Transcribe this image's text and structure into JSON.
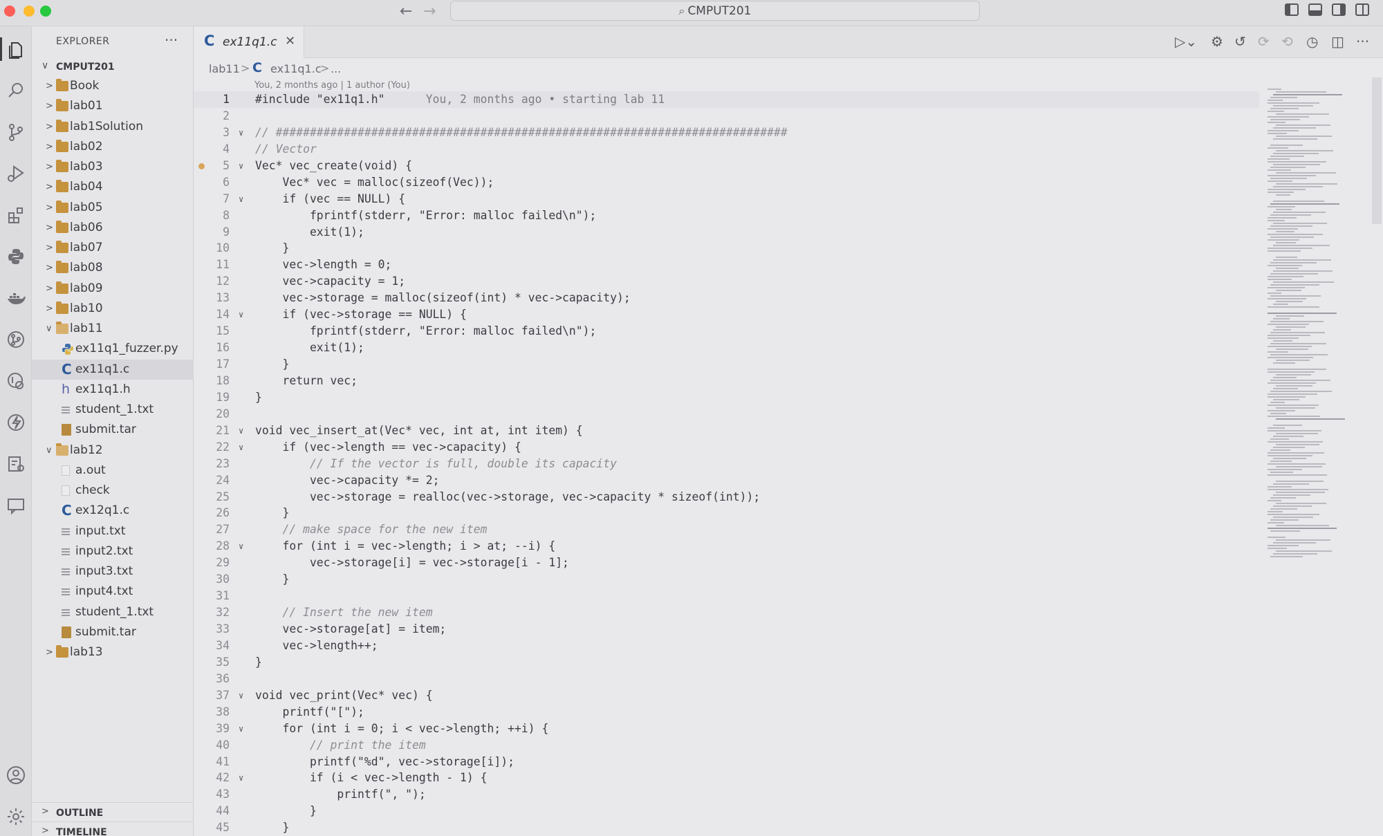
{
  "titlebar": {
    "search_text": "CMPUT201"
  },
  "sidebar": {
    "title": "EXPLORER",
    "workspace": "CMPUT201",
    "items": [
      {
        "name": "Book",
        "type": "folder",
        "depth": 1,
        "open": false
      },
      {
        "name": "lab01",
        "type": "folder",
        "depth": 1,
        "open": false
      },
      {
        "name": "lab1Solution",
        "type": "folder",
        "depth": 1,
        "open": false
      },
      {
        "name": "lab02",
        "type": "folder",
        "depth": 1,
        "open": false
      },
      {
        "name": "lab03",
        "type": "folder",
        "depth": 1,
        "open": false
      },
      {
        "name": "lab04",
        "type": "folder",
        "depth": 1,
        "open": false
      },
      {
        "name": "lab05",
        "type": "folder",
        "depth": 1,
        "open": false
      },
      {
        "name": "lab06",
        "type": "folder",
        "depth": 1,
        "open": false
      },
      {
        "name": "lab07",
        "type": "folder",
        "depth": 1,
        "open": false
      },
      {
        "name": "lab08",
        "type": "folder",
        "depth": 1,
        "open": false
      },
      {
        "name": "lab09",
        "type": "folder",
        "depth": 1,
        "open": false
      },
      {
        "name": "lab10",
        "type": "folder",
        "depth": 1,
        "open": false
      },
      {
        "name": "lab11",
        "type": "folder",
        "depth": 1,
        "open": true
      },
      {
        "name": "ex11q1_fuzzer.py",
        "type": "py",
        "depth": 2
      },
      {
        "name": "ex11q1.c",
        "type": "c",
        "depth": 2,
        "selected": true
      },
      {
        "name": "ex11q1.h",
        "type": "h",
        "depth": 2
      },
      {
        "name": "student_1.txt",
        "type": "txt",
        "depth": 2
      },
      {
        "name": "submit.tar",
        "type": "tar",
        "depth": 2
      },
      {
        "name": "lab12",
        "type": "folder",
        "depth": 1,
        "open": true
      },
      {
        "name": "a.out",
        "type": "blank",
        "depth": 2
      },
      {
        "name": "check",
        "type": "blank",
        "depth": 2
      },
      {
        "name": "ex12q1.c",
        "type": "c",
        "depth": 2
      },
      {
        "name": "input.txt",
        "type": "txt",
        "depth": 2
      },
      {
        "name": "input2.txt",
        "type": "txt",
        "depth": 2
      },
      {
        "name": "input3.txt",
        "type": "txt",
        "depth": 2
      },
      {
        "name": "input4.txt",
        "type": "txt",
        "depth": 2
      },
      {
        "name": "student_1.txt",
        "type": "txt",
        "depth": 2
      },
      {
        "name": "submit.tar",
        "type": "tar",
        "depth": 2
      },
      {
        "name": "lab13",
        "type": "folder",
        "depth": 1,
        "open": false
      }
    ],
    "outline_label": "OUTLINE",
    "timeline_label": "TIMELINE"
  },
  "editor": {
    "tab_label": "ex11q1.c",
    "breadcrumb": {
      "folder": "lab11",
      "file": "ex11q1.c",
      "more": "..."
    },
    "blame_header": "You, 2 months ago | 1 author (You)",
    "lines": [
      {
        "n": "1",
        "text": "#include \"ex11q1.h\"",
        "blame": "You, 2 months ago • starting lab 11",
        "current": true
      },
      {
        "n": "2",
        "text": ""
      },
      {
        "n": "3",
        "text": "// ###########################################################################",
        "fold": true
      },
      {
        "n": "4",
        "text": "// Vector"
      },
      {
        "n": "5",
        "text": "Vec* vec_create(void) {",
        "fold": true,
        "dot": true
      },
      {
        "n": "6",
        "text": "    Vec* vec = malloc(sizeof(Vec));"
      },
      {
        "n": "7",
        "text": "    if (vec == NULL) {",
        "fold": true
      },
      {
        "n": "8",
        "text": "        fprintf(stderr, \"Error: malloc failed\\n\");"
      },
      {
        "n": "9",
        "text": "        exit(1);"
      },
      {
        "n": "10",
        "text": "    }"
      },
      {
        "n": "11",
        "text": "    vec->length = 0;"
      },
      {
        "n": "12",
        "text": "    vec->capacity = 1;"
      },
      {
        "n": "13",
        "text": "    vec->storage = malloc(sizeof(int) * vec->capacity);"
      },
      {
        "n": "14",
        "text": "    if (vec->storage == NULL) {",
        "fold": true
      },
      {
        "n": "15",
        "text": "        fprintf(stderr, \"Error: malloc failed\\n\");"
      },
      {
        "n": "16",
        "text": "        exit(1);"
      },
      {
        "n": "17",
        "text": "    }"
      },
      {
        "n": "18",
        "text": "    return vec;"
      },
      {
        "n": "19",
        "text": "}"
      },
      {
        "n": "20",
        "text": ""
      },
      {
        "n": "21",
        "text": "void vec_insert_at(Vec* vec, int at, int item) {",
        "fold": true
      },
      {
        "n": "22",
        "text": "    if (vec->length == vec->capacity) {",
        "fold": true
      },
      {
        "n": "23",
        "text": "        // If the vector is full, double its capacity"
      },
      {
        "n": "24",
        "text": "        vec->capacity *= 2;"
      },
      {
        "n": "25",
        "text": "        vec->storage = realloc(vec->storage, vec->capacity * sizeof(int));"
      },
      {
        "n": "26",
        "text": "    }"
      },
      {
        "n": "27",
        "text": "    // make space for the new item"
      },
      {
        "n": "28",
        "text": "    for (int i = vec->length; i > at; --i) {",
        "fold": true
      },
      {
        "n": "29",
        "text": "        vec->storage[i] = vec->storage[i - 1];"
      },
      {
        "n": "30",
        "text": "    }"
      },
      {
        "n": "31",
        "text": ""
      },
      {
        "n": "32",
        "text": "    // Insert the new item"
      },
      {
        "n": "33",
        "text": "    vec->storage[at] = item;"
      },
      {
        "n": "34",
        "text": "    vec->length++;"
      },
      {
        "n": "35",
        "text": "}"
      },
      {
        "n": "36",
        "text": ""
      },
      {
        "n": "37",
        "text": "void vec_print(Vec* vec) {",
        "fold": true
      },
      {
        "n": "38",
        "text": "    printf(\"[\");"
      },
      {
        "n": "39",
        "text": "    for (int i = 0; i < vec->length; ++i) {",
        "fold": true
      },
      {
        "n": "40",
        "text": "        // print the item"
      },
      {
        "n": "41",
        "text": "        printf(\"%d\", vec->storage[i]);"
      },
      {
        "n": "42",
        "text": "        if (i < vec->length - 1) {",
        "fold": true
      },
      {
        "n": "43",
        "text": "            printf(\", \");"
      },
      {
        "n": "44",
        "text": "        }"
      },
      {
        "n": "45",
        "text": "    }"
      }
    ]
  }
}
